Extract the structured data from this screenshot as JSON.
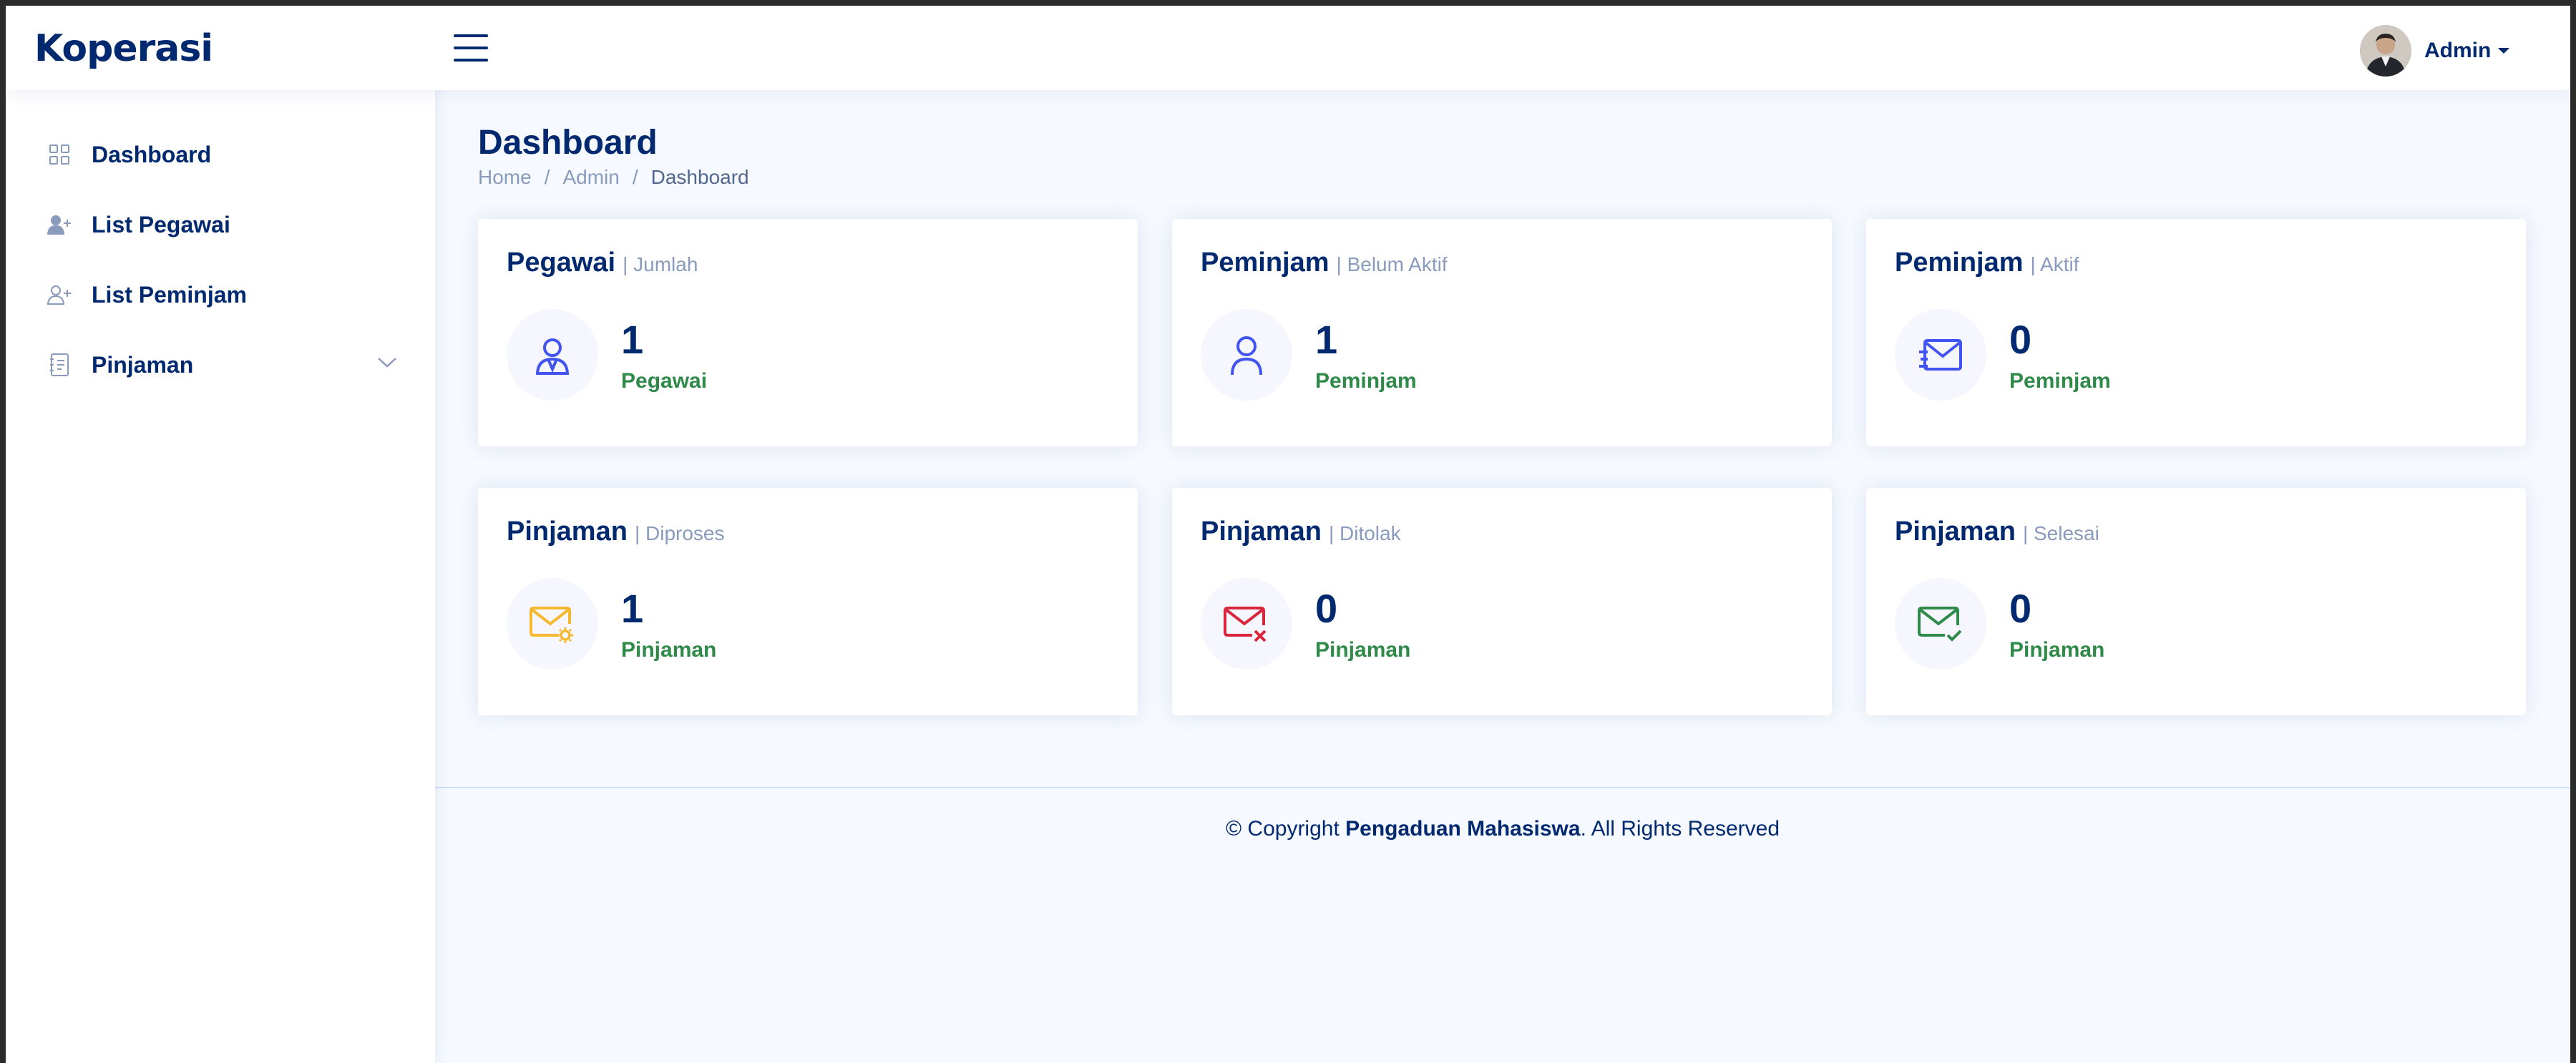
{
  "app": {
    "logo": "Koperasi"
  },
  "header": {
    "user_name": "Admin"
  },
  "sidebar": {
    "items": [
      {
        "label": "Dashboard",
        "icon": "grid-icon"
      },
      {
        "label": "List Pegawai",
        "icon": "person-add-icon"
      },
      {
        "label": "List Peminjam",
        "icon": "person-add-icon"
      },
      {
        "label": "Pinjaman",
        "icon": "journal-text-icon",
        "has_submenu": true
      }
    ]
  },
  "page": {
    "title": "Dashboard",
    "breadcrumb": [
      "Home",
      "Admin",
      "Dashboard"
    ]
  },
  "cards": [
    {
      "title": "Pegawai",
      "subtitle": "| Jumlah",
      "value": "1",
      "label": "Pegawai",
      "icon": "person-badge-icon",
      "icon_color": "#4154f1"
    },
    {
      "title": "Peminjam",
      "subtitle": "| Belum Aktif",
      "value": "1",
      "label": "Peminjam",
      "icon": "person-icon",
      "icon_color": "#4154f1"
    },
    {
      "title": "Peminjam",
      "subtitle": "| Aktif",
      "value": "0",
      "label": "Peminjam",
      "icon": "envelope-fast-icon",
      "icon_color": "#4154f1"
    },
    {
      "title": "Pinjaman",
      "subtitle": "| Diproses",
      "value": "1",
      "label": "Pinjaman",
      "icon": "envelope-gear-icon",
      "icon_color": "#f5b82e"
    },
    {
      "title": "Pinjaman",
      "subtitle": "| Ditolak",
      "value": "0",
      "label": "Pinjaman",
      "icon": "envelope-x-icon",
      "icon_color": "#d9263c"
    },
    {
      "title": "Pinjaman",
      "subtitle": "| Selesai",
      "value": "0",
      "label": "Pinjaman",
      "icon": "envelope-check-icon",
      "icon_color": "#2f8a4a"
    }
  ],
  "footer": {
    "prefix": "© Copyright",
    "brand": "Pengaduan Mahasiswa",
    "suffix": ". All Rights Reserved"
  },
  "colors": {
    "primary": "#012970",
    "accent": "#4154f1",
    "success_text": "#2f8a4a",
    "muted": "#899bbd"
  }
}
